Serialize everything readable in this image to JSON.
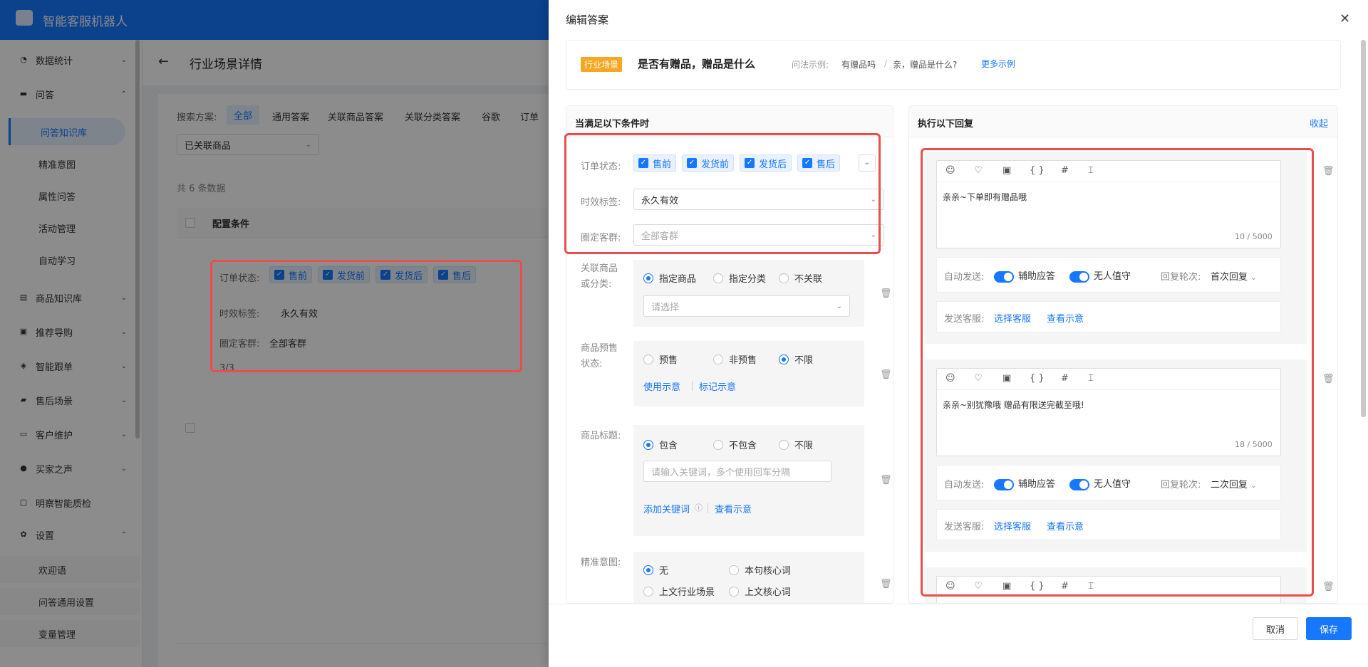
{
  "app": {
    "title": "智能客服机器人"
  },
  "sidebar": {
    "items": [
      {
        "label": "数据统计",
        "icon": "pie-chart-icon",
        "arrow": "⌄"
      },
      {
        "label": "问答",
        "icon": "chat-icon",
        "arrow": "⌃"
      },
      {
        "label": "商品知识库",
        "icon": "box-icon",
        "arrow": "⌄"
      },
      {
        "label": "推荐导购",
        "icon": "cart-icon",
        "arrow": "⌄"
      },
      {
        "label": "智能跟单",
        "icon": "layers-icon",
        "arrow": "⌄"
      },
      {
        "label": "售后场景",
        "icon": "truck-icon",
        "arrow": "⌄"
      },
      {
        "label": "客户维护",
        "icon": "card-icon",
        "arrow": "⌄"
      },
      {
        "label": "买家之声",
        "icon": "voice-icon",
        "arrow": "⌄"
      },
      {
        "label": "明察智能质检",
        "icon": "inspect-icon",
        "arrow": ""
      },
      {
        "label": "设置",
        "icon": "gear-icon",
        "arrow": "⌃"
      }
    ],
    "qa_sub": [
      "问答知识库",
      "精准意图",
      "属性问答",
      "活动管理",
      "自动学习"
    ],
    "settings_sub": [
      "欢迎语",
      "问答通用设置",
      "变量管理"
    ]
  },
  "main": {
    "back": "←",
    "title": "行业场景详情",
    "filter_label": "搜索方案:",
    "filters": [
      "全部",
      "通用答案",
      "关联商品答案",
      "关联分类答案",
      "谷歌",
      "订单"
    ],
    "select_value": "已关联商品",
    "count": "共 6 条数据",
    "col_header": "配置条件",
    "card": {
      "order_label": "订单状态:",
      "order_tags": [
        "售前",
        "发货前",
        "发货后",
        "售后"
      ],
      "time_label": "时效标签:",
      "time_value": "永久有效",
      "group_label": "圈定客群:",
      "group_value": "全部客群",
      "pager": "3/3"
    }
  },
  "drawer": {
    "title": "编辑答案",
    "close": "✕",
    "scene_tag": "行业场景",
    "question": "是否有赠品，赠品是什么",
    "example_label": "问法示例:",
    "example_1": "有赠品吗",
    "example_sep": "/",
    "example_2": "亲，赠品是什么?",
    "more_examples": "更多示例",
    "left": {
      "header": "当满足以下条件时",
      "order_label": "订单状态:",
      "order_tags": [
        "售前",
        "发货前",
        "发货后",
        "售后"
      ],
      "time_label": "时效标签:",
      "time_value": "永久有效",
      "group_label": "圈定客群:",
      "group_placeholder": "全部客群",
      "assoc_label": "关联商品或分类:",
      "assoc_options": [
        "指定商品",
        "指定分类",
        "不关联"
      ],
      "assoc_placeholder": "请选择",
      "presale_label": "商品预售状态:",
      "presale_options": [
        "预售",
        "非预售",
        "不限"
      ],
      "presale_links": [
        "使用示意",
        "标记示意"
      ],
      "title_label": "商品标题:",
      "title_options": [
        "包含",
        "不包含",
        "不限"
      ],
      "title_placeholder": "请输入关键词，多个使用回车分隔",
      "title_links": [
        "添加关键词",
        "查看示意"
      ],
      "intent_label": "精准意图:",
      "intent_options": [
        "无",
        "本句核心词",
        "上文行业场景",
        "上文核心词"
      ]
    },
    "right": {
      "header": "执行以下回复",
      "collapse": "收起",
      "replies": [
        {
          "text": "亲亲~下单即有赠品哦",
          "count": "10 / 5000",
          "auto_label": "自动发送:",
          "toggle1": "辅助应答",
          "toggle2": "无人值守",
          "round_label": "回复轮次:",
          "round_value": "首次回复",
          "send_label": "发送客服:",
          "send_link": "选择客服",
          "view_link": "查看示意"
        },
        {
          "text": "亲亲~别犹豫哦 赠品有限送完截至哦!",
          "count": "18 / 5000",
          "auto_label": "自动发送:",
          "toggle1": "辅助应答",
          "toggle2": "无人值守",
          "round_label": "回复轮次:",
          "round_value": "二次回复",
          "send_label": "发送客服:",
          "send_link": "选择客服",
          "view_link": "查看示意"
        }
      ],
      "toolbar": [
        "☺",
        "♡",
        "▣",
        "{ }",
        "#",
        "⌶"
      ]
    },
    "cancel": "取消",
    "save": "保存"
  },
  "colors": {
    "primary": "#1677ff",
    "highlight": "#e94e4e",
    "tag": "#f5a623"
  }
}
